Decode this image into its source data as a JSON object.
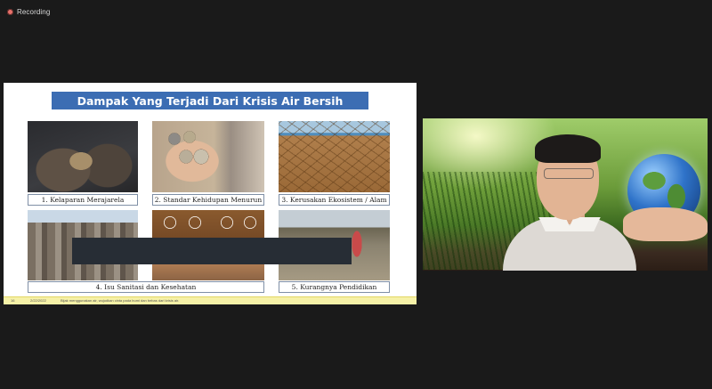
{
  "recording": {
    "label": "Recording"
  },
  "slide": {
    "title": "Dampak Yang Terjadi Dari Krisis Air Bersih",
    "tiles": [
      {
        "caption": "1. Kelaparan Merajarela"
      },
      {
        "caption": "2. Standar Kehidupan Menurun"
      },
      {
        "caption": "3. Kerusakan Ekosistem / Alam"
      },
      {
        "caption": "4. Isu Sanitasi dan Kesehatan"
      },
      {
        "caption": "5. Kurangnya Pendidikan"
      }
    ],
    "footer": {
      "page": "16",
      "date": "2/22/2022",
      "text": "Bijak menggunakan air, wujudkan cinta pada bumi dan bebas dari krisis air."
    }
  },
  "colors": {
    "title_bar": "#3c6db3",
    "footer_bar": "#f6f1a7",
    "background": "#1a1a1a"
  }
}
